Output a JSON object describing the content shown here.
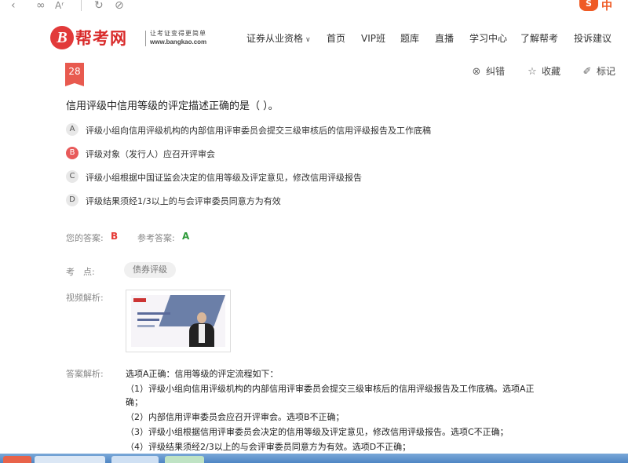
{
  "browser": {
    "app_badge": "S",
    "app_text": "中"
  },
  "header": {
    "logo_mark": "B",
    "logo_name": "帮考网",
    "logo_slogan": "让考证变得更简单",
    "logo_url": "www.bangkao.com",
    "nav": [
      "证券从业资格",
      "首页",
      "VIP班",
      "题库",
      "直播",
      "学习中心",
      "了解帮考",
      "投诉建议"
    ]
  },
  "question": {
    "number": "28",
    "title": "信用评级中信用等级的评定描述正确的是（ ）。",
    "actions": {
      "report": "纠错",
      "favorite": "收藏",
      "mark": "标记"
    },
    "options": [
      {
        "letter": "A",
        "text": "评级小组向信用评级机构的内部信用评审委员会提交三级审核后的信用评级报告及工作底稿",
        "selected": false
      },
      {
        "letter": "B",
        "text": "评级对象（发行人）应召开评审会",
        "selected": true
      },
      {
        "letter": "C",
        "text": "评级小组根据中国证监会决定的信用等级及评定意见，修改信用评级报告",
        "selected": false
      },
      {
        "letter": "D",
        "text": "评级结果须经1/3以上的与会评审委员同意方为有效",
        "selected": false
      }
    ],
    "your_answer_label": "您的答案:",
    "your_answer": "B",
    "ref_answer_label": "参考答案:",
    "ref_answer": "A",
    "point_label": "考　点:",
    "point_tag": "债券评级",
    "video_label": "视频解析:",
    "explanation_label": "答案解析:",
    "explanation": [
      "选项A正确：信用等级的评定流程如下：",
      "（1）评级小组向信用评级机构的内部信用评审委员会提交三级审核后的信用评级报告及工作底稿。选项A正",
      "确；",
      "（2）内部信用评审委员会应召开评审会。选项B不正确；",
      "（3）评级小组根据信用评审委员会决定的信用等级及评定意见，修改信用评级报告。选项C不正确；",
      "（4）评级结果须经2/3以上的与会评审委员同意方为有效。选项D不正确；"
    ]
  },
  "colors": {
    "accent_red": "#e85a4f",
    "wrong_answer": "#e53935",
    "right_answer": "#2e9a3a"
  }
}
